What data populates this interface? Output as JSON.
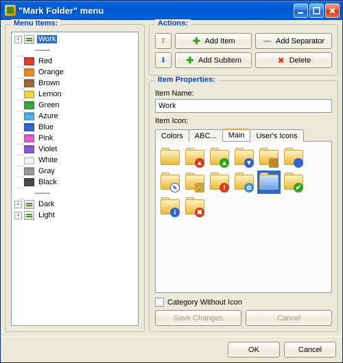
{
  "window": {
    "title": "\"Mark Folder\" menu"
  },
  "menu_items_title": "Menu Items:",
  "tree": {
    "work": "Work",
    "sep": "------",
    "red": "Red",
    "orange": "Orange",
    "brown": "Brown",
    "lemon": "Lemon",
    "green": "Green",
    "azure": "Azure",
    "blue": "Blue",
    "pink": "Pink",
    "violet": "Violet",
    "white": "White",
    "gray": "Gray",
    "black": "Black",
    "dark": "Dark",
    "light": "Light"
  },
  "colors": {
    "work": "#f2c866",
    "red": "#e13d2d",
    "orange": "#f08a2a",
    "brown": "#a06a3a",
    "lemon": "#e9d74a",
    "green": "#3aa646",
    "azure": "#4fb3e6",
    "blue": "#2f63d6",
    "pink": "#e65bcd",
    "violet": "#8a5bd6",
    "white": "#f2f2f2",
    "gray": "#9a9a9a",
    "black": "#4a4a4a",
    "dark": "#f2c866",
    "light": "#f2c866"
  },
  "actions": {
    "title": "Actions:",
    "add_item": "Add Item",
    "add_separator": "Add Separator",
    "add_subitem": "Add Subitem",
    "delete": "Delete"
  },
  "props": {
    "title": "Item Properties:",
    "name_label": "Item Name:",
    "name_value": "Work",
    "icon_label": "Item Icon:",
    "tabs": {
      "colors": "Colors",
      "abc": "ABC...",
      "main": "Main",
      "users": "User's Icons"
    },
    "category_without_icon": "Category Without Icon",
    "save": "Save Changes",
    "cancel": "Cancel"
  },
  "footer": {
    "ok": "OK",
    "cancel": "Cancel"
  }
}
